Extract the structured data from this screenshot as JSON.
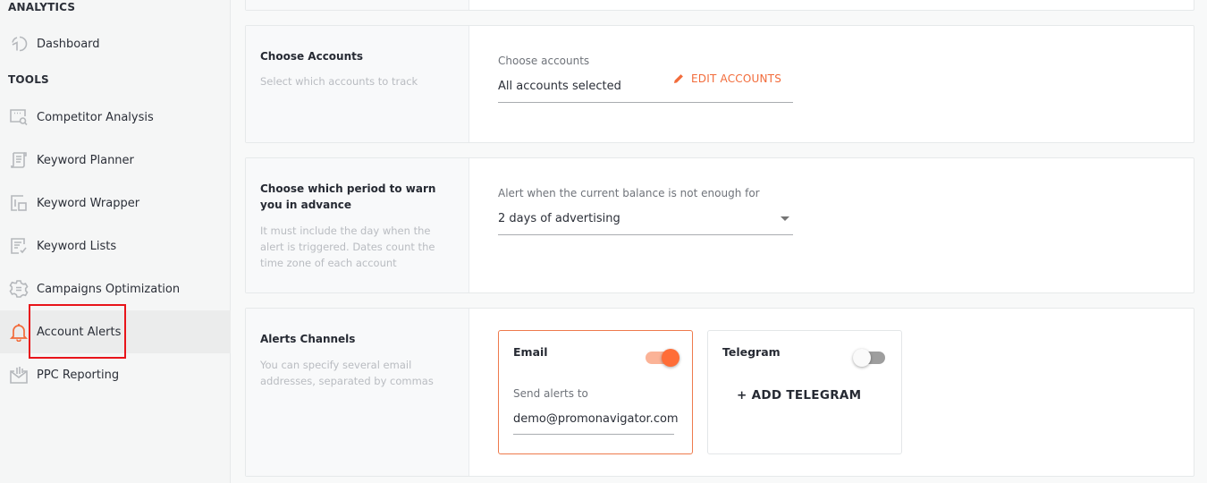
{
  "sidebar": {
    "sections": [
      {
        "title": "ANALYTICS"
      },
      {
        "title": "TOOLS"
      }
    ],
    "items": [
      {
        "label": "Dashboard",
        "icon": "dashboard-pie-icon"
      },
      {
        "label": "Competitor Analysis",
        "icon": "competitor-search-icon"
      },
      {
        "label": "Keyword Planner",
        "icon": "keyword-planner-icon"
      },
      {
        "label": "Keyword Wrapper",
        "icon": "keyword-wrapper-icon"
      },
      {
        "label": "Keyword Lists",
        "icon": "keyword-lists-icon"
      },
      {
        "label": "Campaigns Optimization",
        "icon": "gear-icon"
      },
      {
        "label": "Account Alerts",
        "icon": "bell-icon",
        "active": true
      },
      {
        "label": "PPC Reporting",
        "icon": "ppc-report-icon"
      }
    ]
  },
  "accounts_card": {
    "title": "Choose Accounts",
    "description": "Select which accounts to track",
    "field_label": "Choose accounts",
    "field_value": "All accounts selected",
    "edit_label": "EDIT ACCOUNTS"
  },
  "period_card": {
    "title": "Choose which period to warn you in advance",
    "description": "It must include the day when the alert is triggered. Dates count the time zone of each account",
    "field_label": "Alert when the current balance is not enough for",
    "selected_value": "2 days of advertising"
  },
  "channels_card": {
    "title": "Alerts Channels",
    "description": "You can specify several email addresses, separated by commas",
    "email": {
      "title": "Email",
      "enabled": true,
      "field_label": "Send alerts to",
      "value": "demo@promonavigator.com"
    },
    "telegram": {
      "title": "Telegram",
      "enabled": false,
      "add_label": "+ ADD TELEGRAM"
    }
  },
  "colors": {
    "accent": "#f26b3a",
    "highlight": "#e8141a"
  }
}
